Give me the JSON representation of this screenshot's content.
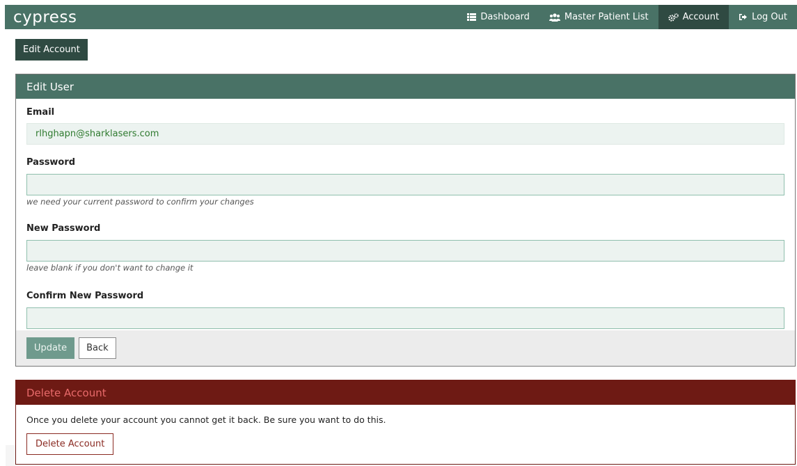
{
  "brand": "cypress",
  "nav": {
    "items": [
      {
        "label": "Dashboard",
        "icon": "list-icon",
        "active": false
      },
      {
        "label": "Master Patient List",
        "icon": "users-icon",
        "active": false
      },
      {
        "label": "Account",
        "icon": "gears-icon",
        "active": true
      },
      {
        "label": "Log Out",
        "icon": "sign-out-icon",
        "active": false
      }
    ]
  },
  "edit_account_tab": "Edit Account",
  "edit_user": {
    "title": "Edit User",
    "email_label": "Email",
    "email_value": "rlhghapn@sharklasers.com",
    "password_label": "Password",
    "password_value": "",
    "password_hint": "we need your current password to confirm your changes",
    "new_password_label": "New Password",
    "new_password_value": "",
    "new_password_hint": "leave blank if you don't want to change it",
    "confirm_label": "Confirm New Password",
    "confirm_value": "",
    "update_button": "Update",
    "back_button": "Back"
  },
  "delete_account": {
    "title": "Delete Account",
    "message": "Once you delete your account you cannot get it back. Be sure you want to do this.",
    "button": "Delete Account"
  },
  "colors": {
    "header_green": "#497266",
    "active_nav": "#2f4a42",
    "danger": "#6e1a14",
    "input_bg": "#ecf3f0",
    "input_border": "#8fbfad"
  }
}
